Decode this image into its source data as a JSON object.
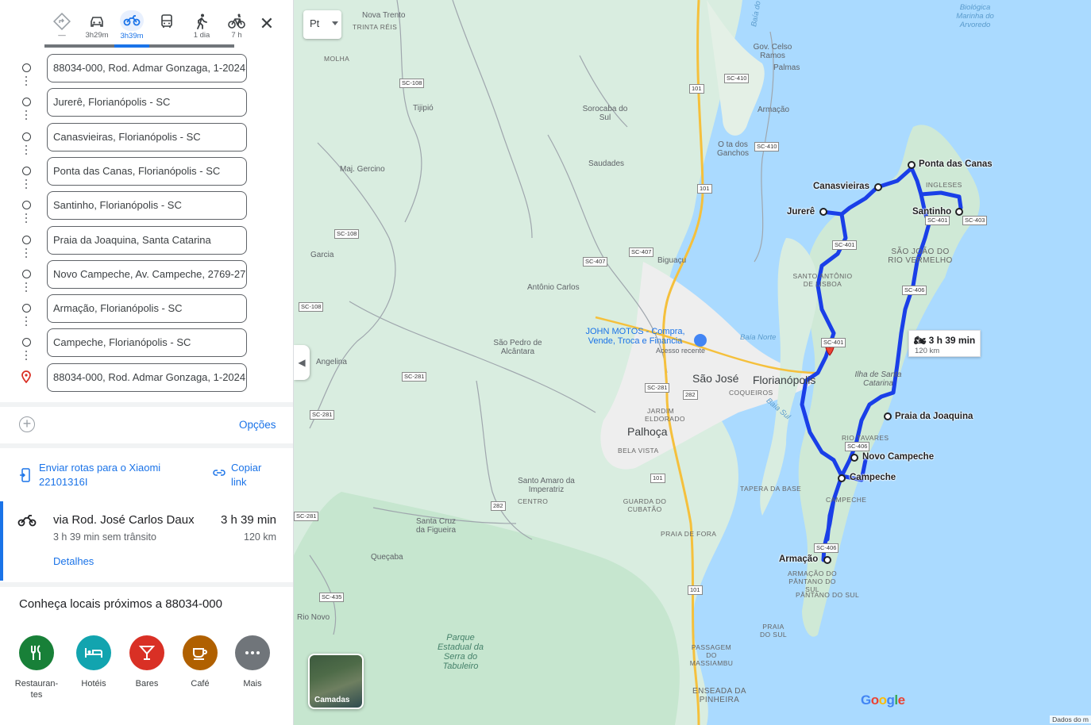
{
  "travel_modes": [
    {
      "name": "best",
      "label": "—"
    },
    {
      "name": "car",
      "label": "3h29m"
    },
    {
      "name": "motorcycle",
      "label": "3h39m",
      "active": true
    },
    {
      "name": "transit",
      "label": ""
    },
    {
      "name": "walk",
      "label": "1 dia"
    },
    {
      "name": "bike",
      "label": "7 h"
    }
  ],
  "close_label": "✕",
  "waypoints": [
    "88034-000, Rod. Admar Gonzaga, 1-2024",
    "Jurerê, Florianópolis - SC",
    "Canasvieiras, Florianópolis - SC",
    "Ponta das Canas, Florianópolis - SC",
    "Santinho, Florianópolis - SC",
    "Praia da Joaquina, Santa Catarina",
    "Novo Campeche, Av. Campeche, 2769-2773",
    "Armação, Florianópolis - SC",
    "Campeche, Florianópolis - SC",
    "88034-000, Rod. Admar Gonzaga, 1-2024"
  ],
  "options_label": "Opções",
  "send": {
    "line1": "Enviar rotas para o Xiaomi",
    "line2": "22101316I"
  },
  "copy": {
    "line1": "Copiar",
    "line2": "link"
  },
  "route": {
    "via": "via Rod. José Carlos Daux",
    "time": "3 h 39 min",
    "sub": "3 h 39 min sem trânsito",
    "distance": "120 km",
    "details": "Detalhes"
  },
  "nearby": {
    "title": "Conheça locais próximos a 88034-000",
    "categories": [
      {
        "label": "Restauran-tes",
        "color": "#188038"
      },
      {
        "label": "Hotéis",
        "color": "#12a4af"
      },
      {
        "label": "Bares",
        "color": "#d93025"
      },
      {
        "label": "Café",
        "color": "#b06000"
      },
      {
        "label": "Mais",
        "color": "#70757a"
      }
    ]
  },
  "map": {
    "lang_button": "Pt",
    "tooltip": {
      "time": "3 h 39 min",
      "distance": "120 km"
    },
    "layers_label": "Camadas",
    "google_logo": "Google",
    "attribution": "Dados do m",
    "waypoint_labels": [
      "Ponta das Canas",
      "Canasvieiras",
      "Jurerê",
      "Santinho",
      "Praia da Joaquina",
      "Novo Campeche",
      "Campeche",
      "Armação"
    ],
    "big_labels": [
      "São José",
      "Florianópolis",
      "Palhoça"
    ],
    "place_labels": [
      "Nova Trento",
      "TRINTA RÉIS",
      "MOLHA",
      "Tijipió",
      "Sorocaba do Sul",
      "Saudades",
      "Maj. Gercino",
      "Garcia",
      "Antônio Carlos",
      "São Pedro de Alcântara",
      "Angelina",
      "Biguaçu",
      "Santo Amaro da Imperatriz",
      "Santa Cruz da Figueira",
      "Queçaba",
      "Rio Novo",
      "Gov. Celso Ramos",
      "Palmas",
      "Armação",
      "O ta dos Ganchos",
      "SÃO JOÃO DO RIO VERMELHO",
      "SANTO ANTÔNIO DE LISBOA",
      "JARDIM ELDORADO",
      "BELA VISTA",
      "COQUEIROS",
      "GUARDA DO CUBATÃO",
      "PRAIA DE FORA",
      "TAPERA DA BASE",
      "ARMAÇÃO DO PÂNTANO DO SUL",
      "PÂNTANO DO SUL",
      "PRAIA DO SUL",
      "ENSEADA DA PINHEIRA",
      "PASSAGEM DO MASSIAMBU",
      "RIO TAVARES",
      "CENTRO",
      "INGLESES",
      "Biológica Marinha do Arvoredo",
      "Baía Norte",
      "Baía Sul",
      "Ilha de Santa Catarina",
      "CAMPECHE",
      "Baía do",
      "Acesso recente"
    ],
    "business_label": "JOHN MOTOS - Compra, Vende, Troca e Financia",
    "park_label": "Parque Estadual da Serra do Tabuleiro",
    "road_shields": [
      "SC-108",
      "SC-410",
      "101",
      "SC-410",
      "SC-108",
      "SC-407",
      "SC-407",
      "101",
      "SC-108",
      "SC-281",
      "SC-281",
      "282",
      "SC-281",
      "101",
      "282",
      "SC-435",
      "SC-281",
      "101",
      "SC-401",
      "SC-406",
      "SC-401",
      "SC-406",
      "SC-406",
      "SC-401",
      "SC-403"
    ]
  }
}
